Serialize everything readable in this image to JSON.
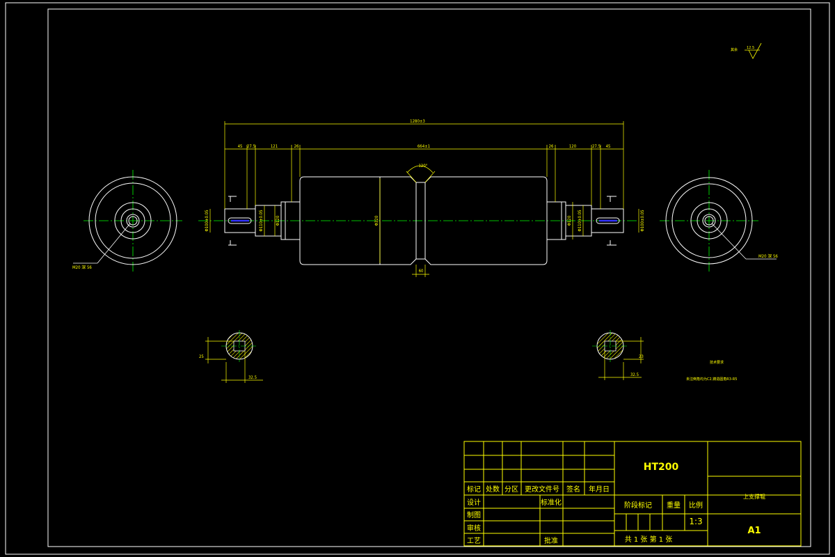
{
  "colors": {
    "background": "#000000",
    "outline": "#ffffff",
    "dimension": "#ffff00",
    "centerline": "#00ff00",
    "keyway": "#3333ff",
    "hatch": "#ffff00"
  },
  "top_right": {
    "note": "其余",
    "roughness": "12.5"
  },
  "dimensions": {
    "total_length": "1280±3",
    "body_length": "664±1",
    "groove_angle": "120°",
    "groove_width": "60",
    "body_diameter": "Φ320",
    "left_shaft_diameter": "Φ120",
    "right_shaft_diameter": "Φ120",
    "left_end_diameter": "Φ100±0.05",
    "left_journal_diameter": "Φ110±0.05",
    "right_end_diameter": "Φ100±0.05",
    "right_journal_diameter": "Φ110±0.05",
    "left_segments": [
      "45",
      "27.5",
      "121",
      "26"
    ],
    "right_segments": [
      "26",
      "120",
      "27.5",
      "45"
    ],
    "left_thread": "M20 深 56",
    "right_thread": "M20 深 56",
    "left_section_height": "25",
    "left_section_width": "32.5",
    "right_section_height": "23",
    "right_section_width": "32.5"
  },
  "tech_requirements": {
    "title": "技术要求",
    "line1": "未注倒角均为C2,铸造圆角R3-R5"
  },
  "title_block": {
    "material": "HT200",
    "drawing_name": "上支撑辊",
    "drawing_code": "A1",
    "headers": [
      "标记",
      "处数",
      "分区",
      "更改文件号",
      "签名",
      "年月日"
    ],
    "design": "设计",
    "standardization": "标准化",
    "drawing": "制图",
    "review": "审核",
    "process": "工艺",
    "approve": "批准",
    "stage_mark": "阶段标记",
    "weight": "重量",
    "scale_label": "比例",
    "scale": "1:3",
    "sheet_info": "共 1 张 第 1 张"
  }
}
